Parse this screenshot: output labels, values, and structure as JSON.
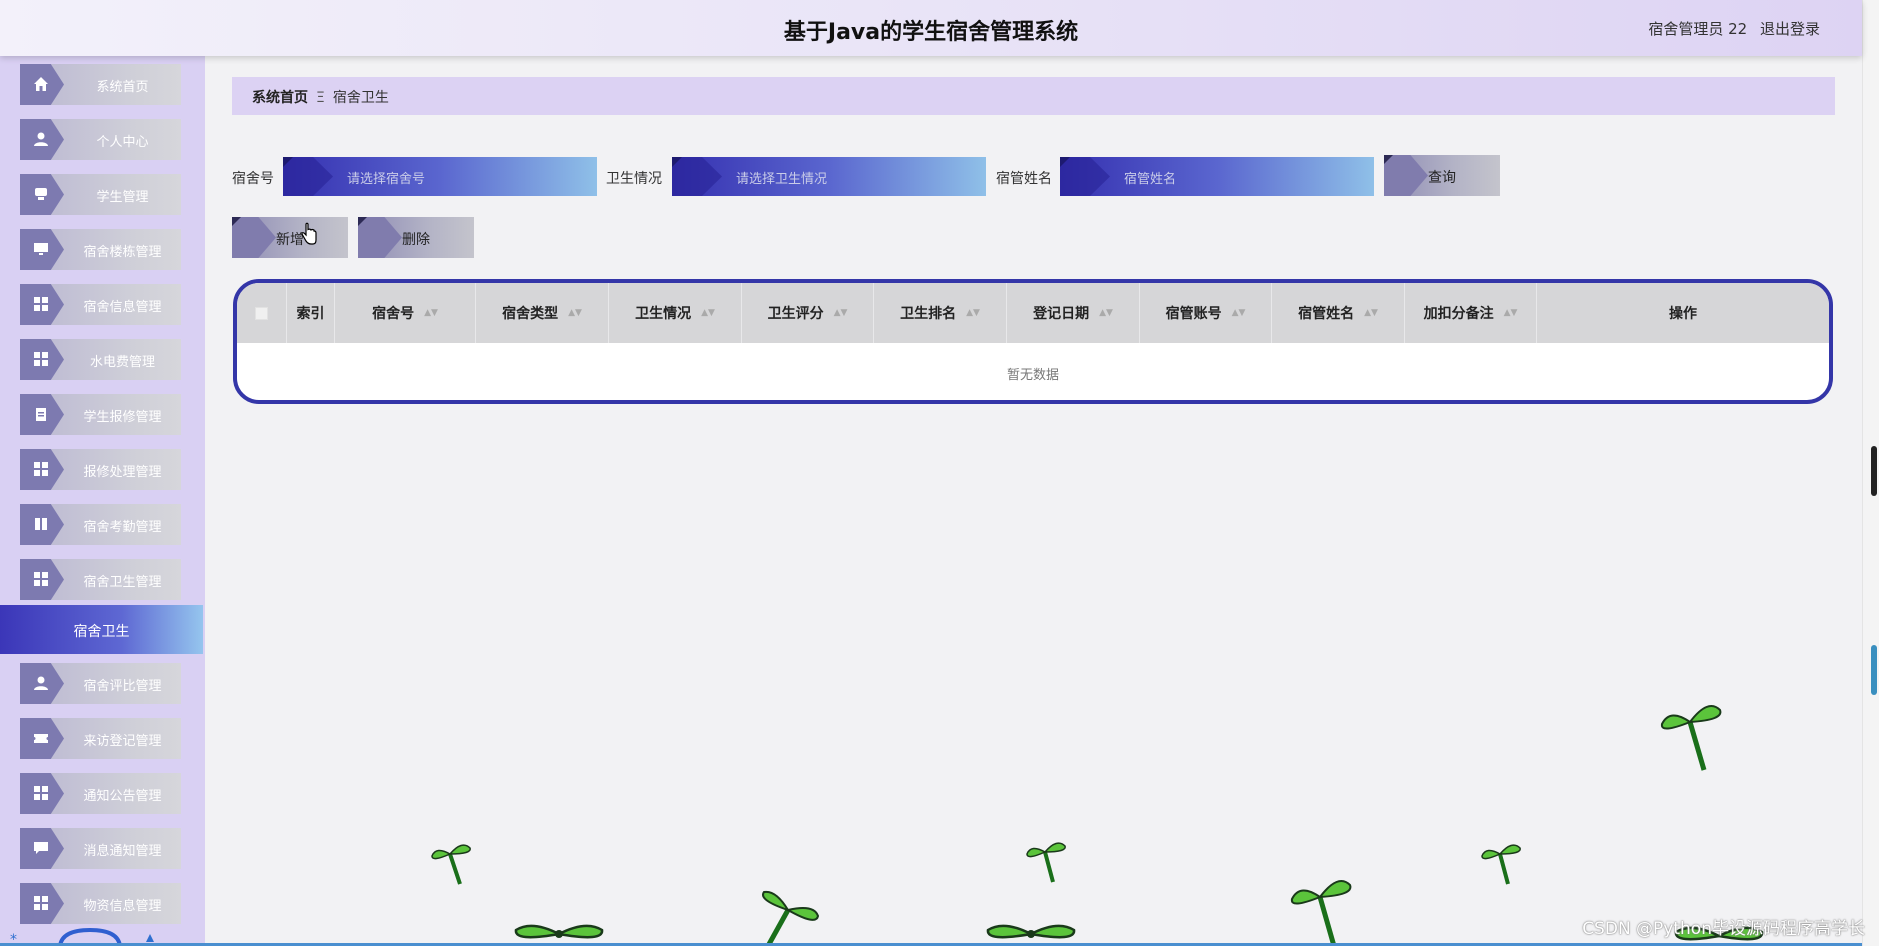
{
  "header": {
    "title": "基于Java的学生宿舍管理系统",
    "user": "宿舍管理员 22",
    "logout": "退出登录"
  },
  "sidebar": {
    "items": [
      {
        "label": "系统首页",
        "icon": "home-icon"
      },
      {
        "label": "个人中心",
        "icon": "user-icon"
      },
      {
        "label": "学生管理",
        "icon": "chair-icon"
      },
      {
        "label": "宿舍楼栋管理",
        "icon": "monitor-icon"
      },
      {
        "label": "宿舍信息管理",
        "icon": "grid-icon"
      },
      {
        "label": "水电费管理",
        "icon": "grid-icon"
      },
      {
        "label": "学生报修管理",
        "icon": "clipboard-icon"
      },
      {
        "label": "报修处理管理",
        "icon": "grid-icon"
      },
      {
        "label": "宿舍考勤管理",
        "icon": "book-icon"
      },
      {
        "label": "宿舍卫生管理",
        "icon": "grid-icon"
      },
      {
        "label": "宿舍评比管理",
        "icon": "user-icon"
      },
      {
        "label": "来访登记管理",
        "icon": "ticket-icon"
      },
      {
        "label": "通知公告管理",
        "icon": "grid-icon"
      },
      {
        "label": "消息通知管理",
        "icon": "chat-icon"
      },
      {
        "label": "物资信息管理",
        "icon": "grid-icon"
      }
    ],
    "active_sub": "宿舍卫生"
  },
  "breadcrumb": {
    "home": "系统首页",
    "separator": "Ξ",
    "current": "宿舍卫生"
  },
  "search": {
    "fields": [
      {
        "label": "宿舍号",
        "placeholder": "请选择宿舍号"
      },
      {
        "label": "卫生情况",
        "placeholder": "请选择卫生情况"
      },
      {
        "label": "宿管姓名",
        "placeholder": "宿管姓名"
      }
    ],
    "query_button": "查询"
  },
  "actions": {
    "add": "新增",
    "delete": "删除"
  },
  "table": {
    "columns": [
      "索引",
      "宿舍号",
      "宿舍类型",
      "卫生情况",
      "卫生评分",
      "卫生排名",
      "登记日期",
      "宿管账号",
      "宿管姓名",
      "加扣分备注",
      "操作"
    ],
    "empty_text": "暂无数据"
  },
  "watermark": "CSDN @Python毕设源码程序高学长",
  "colors": {
    "accent": "#3436a8",
    "sidebar_bg": "#d9d0f3",
    "leaf_green": "#5bc43b"
  }
}
